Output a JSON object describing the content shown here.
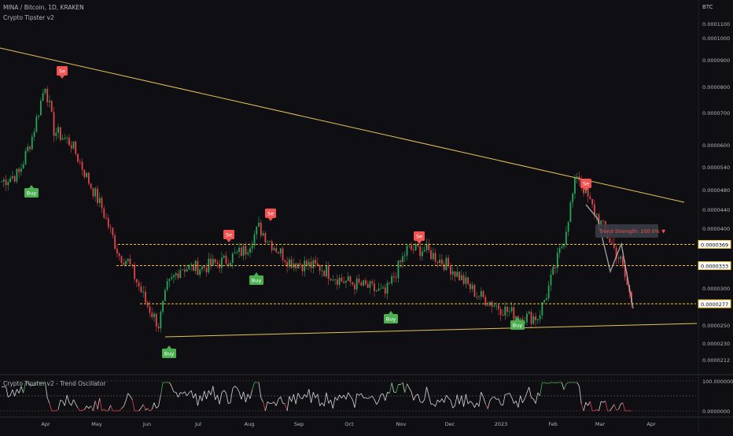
{
  "header": {
    "symbol_line": "MINA / Bitcoin, 1D, KRAKEN",
    "indicator_name": "Crypto Tipster v2",
    "currency": "BTC"
  },
  "oscillator": {
    "title": "Crypto Tipster v2 - Trend Oscillator",
    "top_label": "100.0000000",
    "bottom_label": "0.0000000"
  },
  "colors": {
    "background": "#0f0f13",
    "trendline": "#e8c15a",
    "dashed_level": "#f0c430",
    "buy": "#4caf50",
    "sell": "#f05350",
    "candle_up": "#26a65b",
    "candle_down": "#e0454a",
    "osc_line": "#d6d6d6",
    "osc_high": "#4caf50",
    "osc_low": "#e0454a"
  },
  "chart_data": {
    "type": "candlestick",
    "y_scale": "log",
    "y_ticks": [
      "0.0001100",
      "0.0001000",
      "0.0000900",
      "0.0000800",
      "0.0000700",
      "0.0000600",
      "0.0000540",
      "0.0000480",
      "0.0000440",
      "0.0000400",
      "0.0000300",
      "0.0000250",
      "0.0000230",
      "0.0000212"
    ],
    "y_tick_values": [
      0.00011,
      0.0001,
      9e-05,
      8e-05,
      7e-05,
      6e-05,
      5.4e-05,
      4.8e-05,
      4.4e-05,
      4e-05,
      3e-05,
      2.5e-05,
      2.3e-05,
      2.12e-05
    ],
    "x_ticks": [
      "Apr",
      "May",
      "Jun",
      "Jul",
      "Aug",
      "Sep",
      "Oct",
      "Nov",
      "Dec",
      "2023",
      "Feb",
      "Mar",
      "Apr"
    ],
    "price_tags": [
      {
        "label": "0.0000369",
        "value": 3.69e-05
      },
      {
        "label": "0.0000333",
        "value": 3.33e-05
      },
      {
        "label": "0.0000277",
        "value": 2.77e-05
      }
    ],
    "signals": [
      {
        "type": "sell",
        "label": "Se",
        "date_index": 12
      },
      {
        "type": "buy",
        "label": "Buy",
        "date_index": 5
      },
      {
        "type": "buy",
        "label": "Buy",
        "date_index": 70
      },
      {
        "type": "sell",
        "label": "Se",
        "date_index": 98
      },
      {
        "type": "sell",
        "label": "Se",
        "date_index": 115
      },
      {
        "type": "buy",
        "label": "Buy",
        "date_index": 110
      },
      {
        "type": "sell",
        "label": "Se",
        "date_index": 180
      },
      {
        "type": "buy",
        "label": "Buy",
        "date_index": 168
      },
      {
        "type": "buy",
        "label": "Buy",
        "date_index": 222
      },
      {
        "type": "sell",
        "label": "Se",
        "date_index": 248
      }
    ],
    "annotation": "Trend Strength: 100.0%"
  }
}
